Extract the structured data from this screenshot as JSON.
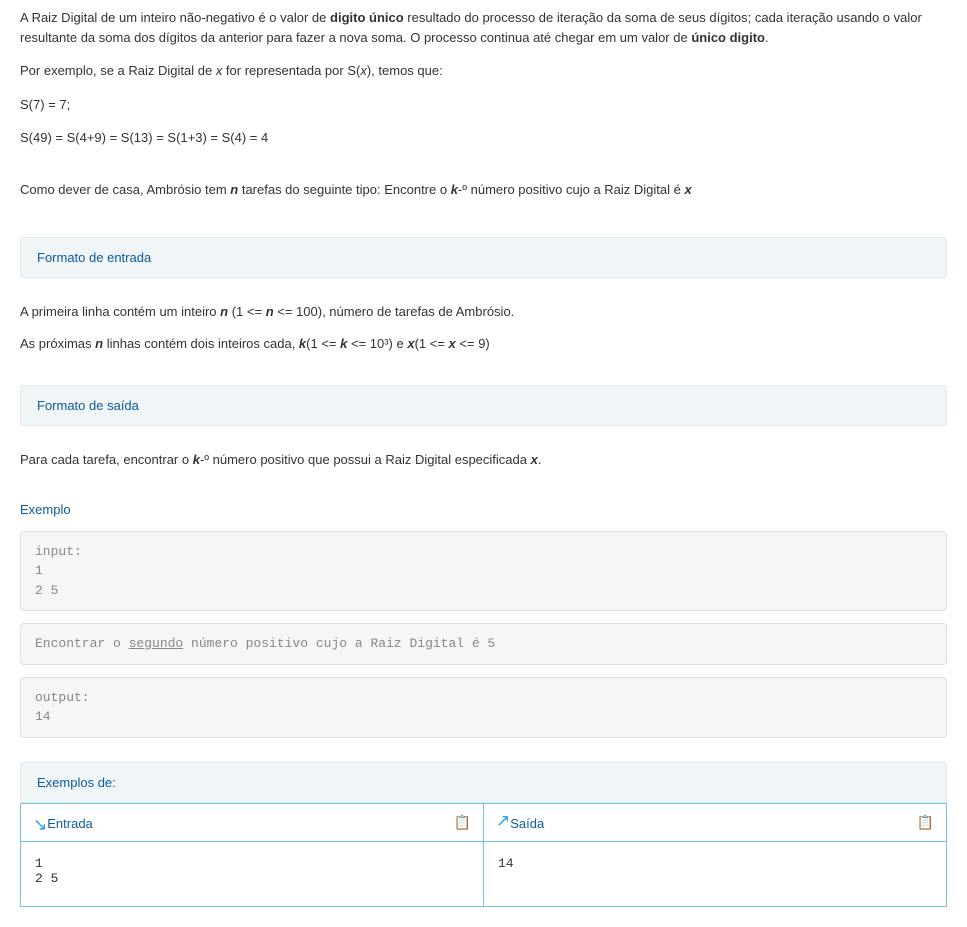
{
  "intro": {
    "p1_pre": "A Raiz Digital de um inteiro não-negativo é o valor de ",
    "p1_bold1": "digito único",
    "p1_mid": " resultado do processo de iteração da soma de seus dígitos; cada iteração usando o valor resultante da soma dos dígitos da anterior para fazer a nova soma. O processo continua até chegar em um valor de ",
    "p1_bold2": "único digito",
    "p1_end": ".",
    "p2_pre": "Por exemplo, se a Raiz Digital de ",
    "p2_x1": "x",
    "p2_mid": " for representada por S(",
    "p2_x2": "x",
    "p2_end": "), temos que:",
    "f1": "S(7) = 7;",
    "f2": "S(49) = S(4+9) = S(13) = S(1+3) = S(4) = 4",
    "p3_pre": "Como dever de casa, Ambrósio tem ",
    "p3_n": "n",
    "p3_mid": " tarefas do seguinte tipo: Encontre o ",
    "p3_k": "k",
    "p3_ord": "-º número positivo cujo a Raiz Digital é ",
    "p3_x": "x"
  },
  "section_input_header": "Formato de entrada",
  "input_desc": {
    "l1_pre": "A primeira linha contém um inteiro ",
    "l1_n": "n",
    "l1_mid1": " (1 <= ",
    "l1_n2": "n",
    "l1_end": " <= 100), número de tarefas de Ambrósio.",
    "l2_pre": "As próximas ",
    "l2_n": "n",
    "l2_mid1": " linhas contém dois inteiros cada, ",
    "l2_k": "k",
    "l2_mid2": "(1 <= ",
    "l2_k2": "k",
    "l2_mid3": " <= 10³) e ",
    "l2_x": "x",
    "l2_mid4": "(1 <= ",
    "l2_x2": "x",
    "l2_end": " <= 9)"
  },
  "section_output_header": "Formato de saída",
  "output_desc": {
    "pre": "Para cada tarefa, encontrar o ",
    "k": "k",
    "mid": "-º número positivo que possui a Raiz Digital especificada ",
    "x": "x",
    "end": "."
  },
  "exemplo_label": "Exemplo",
  "example": {
    "input_label": "input:",
    "input_body": "1\n2 5",
    "explain_pre": "Encontrar o ",
    "explain_underline": "segundo",
    "explain_post": " número positivo cujo a Raiz Digital é 5",
    "output_label": "output:",
    "output_body": "14"
  },
  "exemplos_de": "Exemplos de:",
  "io": {
    "entrada_label": "Entrada",
    "saida_label": "Saída",
    "entrada_data": "1\n2 5",
    "saida_data": "14"
  }
}
